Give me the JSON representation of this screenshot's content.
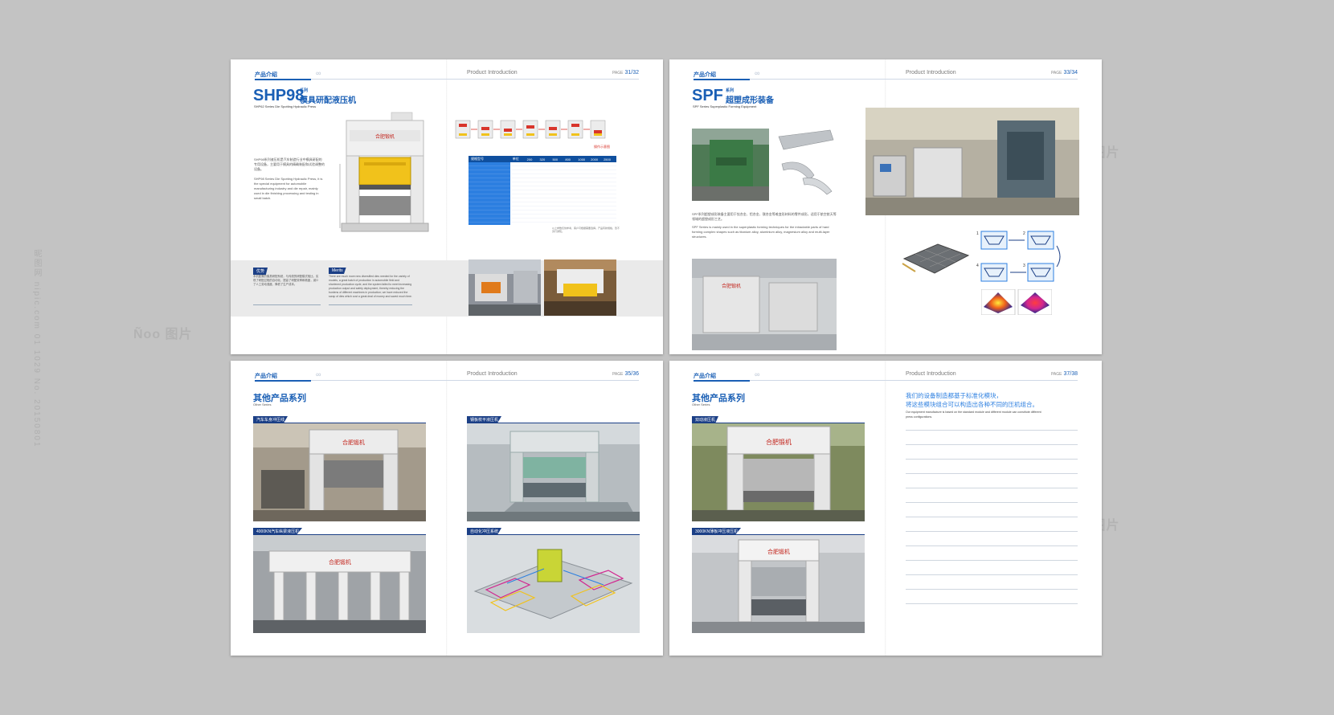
{
  "spreads": [
    {
      "section": "产品介绍",
      "running_title": "Product Introduction",
      "page_prefix": "PAGE",
      "page": "31/32",
      "model": "SHP98",
      "model_suffix": "系列",
      "title_cn": "模具研配液压机",
      "title_en": "SHP62 Series Die Spotting Hydraulic Press",
      "desc_cn": "SHP98系列液压机是汽车制造行业中模具研配的专用设备，主要用于模具的精确装配和试验调整的设备。",
      "desc_en": "SHP98 Series Die Spotting Hydraulic Press, it is the special equipment for automobile manufacturing industry and die repair, mainly used in die finishing processing and testing in small batch.",
      "cycle_label": "操作示意图",
      "table_title": "规格型号",
      "table_cols": [
        "单位",
        "200",
        "320",
        "500",
        "800",
        "1000",
        "2000",
        "2500"
      ],
      "table_footnote": "以上参数仅供参考，客户可根据需要选择。产品有新规格，恕不另行通知。",
      "left_tag": "优势",
      "right_tag": "Merits",
      "merit_cn": "本机配置的模具研配系统，与传统的研配模式相比，实现了研配过程的自动化，提高了研配效率和精度，减少了人工劳动强度，降低了生产成本。",
      "merit_en": "There are much more new diversified dies needed for the variety of models, a great batch of production in automobile field and shortened production cycle, and the system failed to meet increasing production output and safety deployment, thereby reducing the burdens of different machines in production; we have reduced the scrap of dies which cost a great deal of money and saved much time."
    },
    {
      "section": "产品介绍",
      "running_title": "Product Introduction",
      "page_prefix": "PAGE",
      "page": "33/34",
      "model": "SPF",
      "model_suffix": "系列",
      "title_cn": "超塑成形装备",
      "title_en": "SPF Series Superplastic Forming Equipment",
      "desc_cn": "SPF系列超塑成形装备主要用于钛合金、铝合金、镁合金等难变形材料的零件成形，适用于航空航天等领域的超塑成形工艺。",
      "desc_en": "SPF Series is mainly used in the superplastic forming techniques for the intractable parts of hard forming complex shapes such as titanium alloy, aluminium alloy, magnesium alloy and multi-layer structures.",
      "steps": [
        "1",
        "2",
        "3",
        "4"
      ]
    },
    {
      "section": "产品介绍",
      "running_title": "Product Introduction",
      "page_prefix": "PAGE",
      "page": "35/36",
      "title_cn": "其他产品系列",
      "title_en": "Other Series",
      "captions": [
        "汽车车身冲压线",
        "钢板校平液压机",
        "4000KN汽车纵梁液压机",
        "自动化冲压系统"
      ]
    },
    {
      "section": "产品介绍",
      "running_title": "Product Introduction",
      "page_prefix": "PAGE",
      "page": "37/38",
      "title_cn": "其他产品系列",
      "title_en": "Other Series",
      "captions": [
        "双动液压机",
        "3000KN薄板冲压液压机"
      ],
      "note_cn_1": "我们的设备制造都基于标准化模块，",
      "note_cn_2": "将这些模块组合可以构造出各种不同的压机组合。",
      "note_en": "Our equipment manufacture is based on the standard module and different module can constitute different press configurations.",
      "note_line_count": 13
    }
  ],
  "brand_plate": "合肥锻机",
  "watermark": "Ñoo 图片",
  "vertical_text": "昵图网 nipic.com 01 1029 No. 20150801",
  "colors": {
    "brand_blue": "#1a5fb5",
    "tag_navy": "#1b3f86",
    "machine_yellow": "#f1c21b",
    "table_blue": "#1e6fd0"
  }
}
